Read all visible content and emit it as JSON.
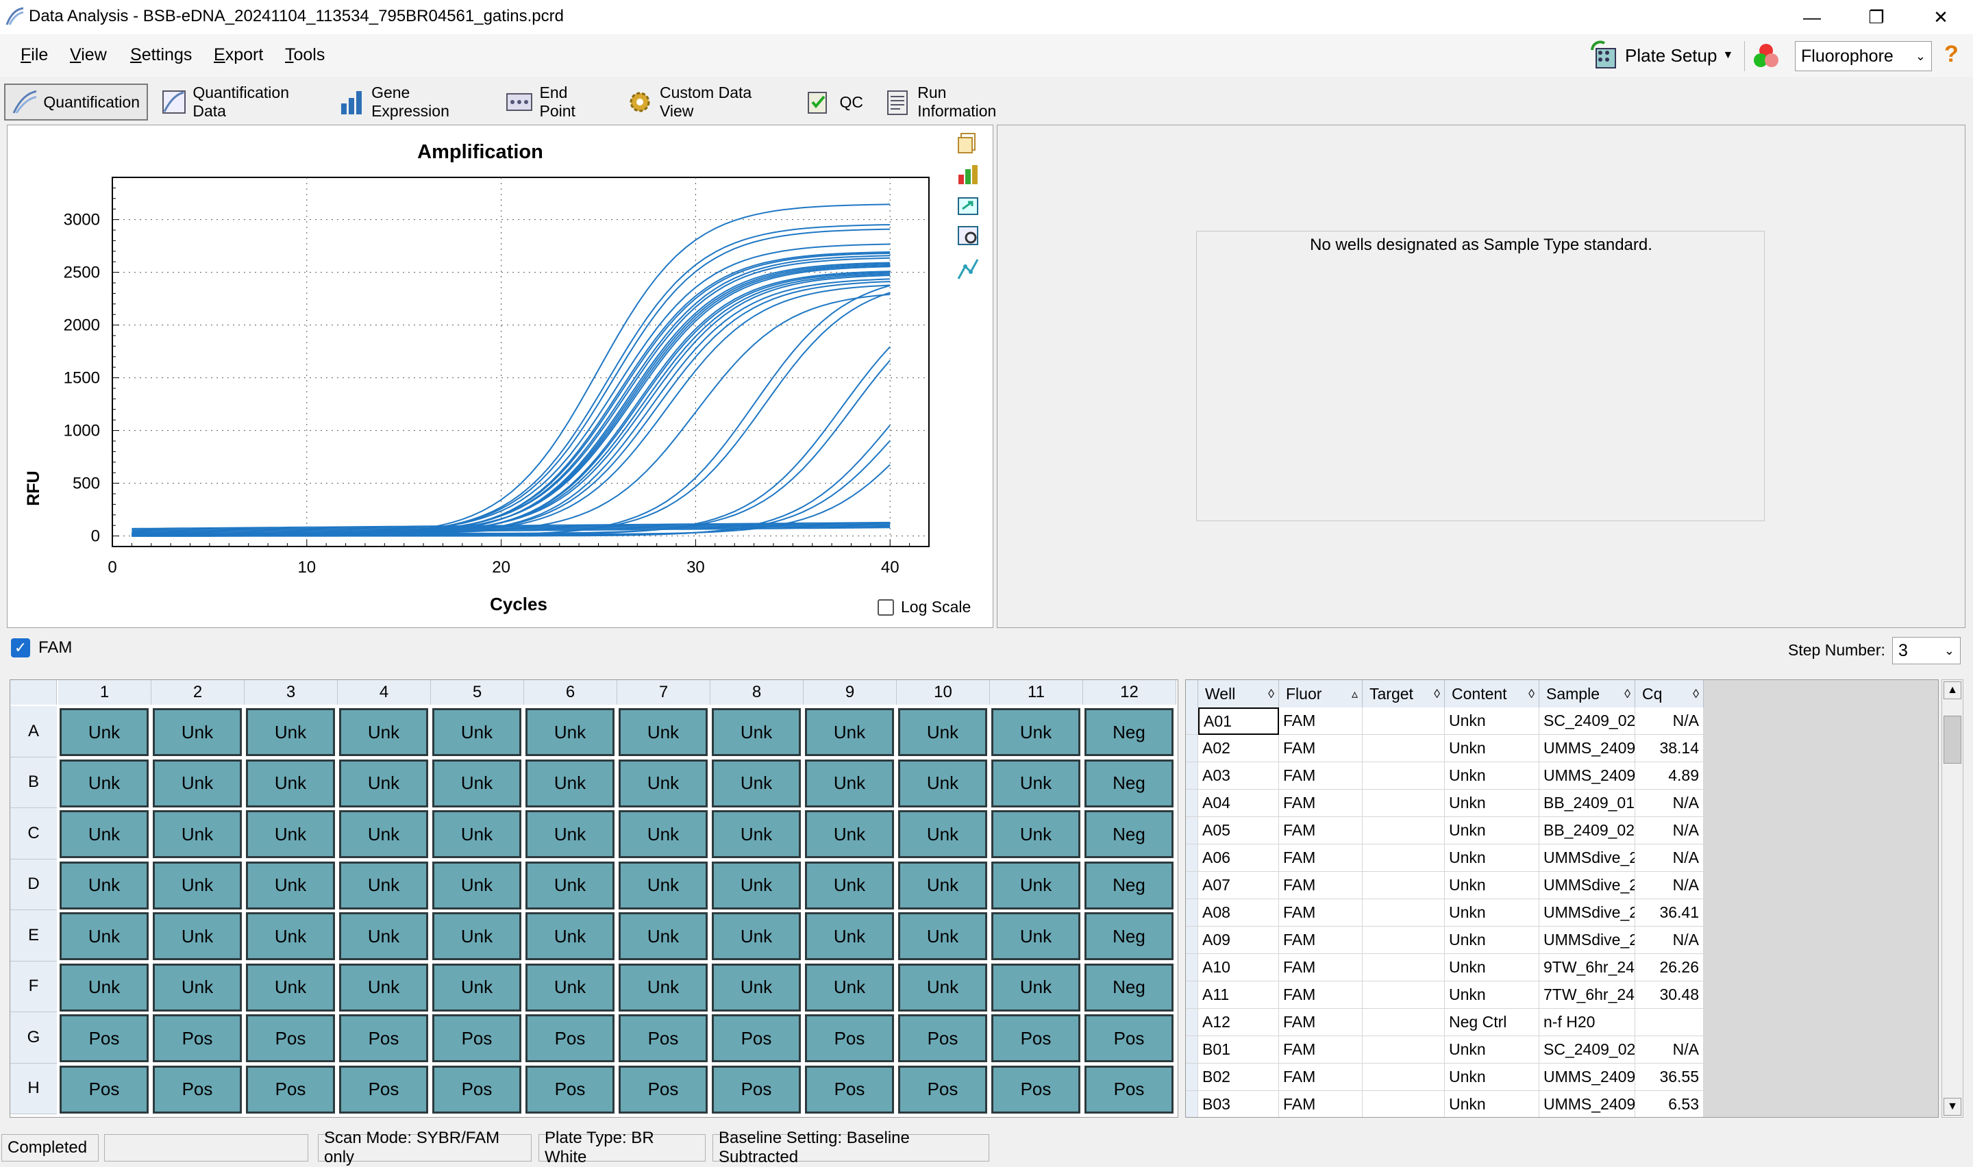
{
  "window": {
    "title": "Data Analysis - BSB-eDNA_20241104_113534_795BR04561_gatins.pcrd",
    "minimize": "—",
    "maximize": "❐",
    "close": "✕"
  },
  "menu": [
    "File",
    "View",
    "Settings",
    "Export",
    "Tools"
  ],
  "header_right": {
    "plate_setup": "Plate Setup",
    "fluorophore_select": "Fluorophore",
    "help": "?"
  },
  "tabs": [
    {
      "label": "Quantification",
      "icon": "amplification-icon",
      "active": true
    },
    {
      "label": "Quantification Data",
      "icon": "quant-data-icon"
    },
    {
      "label": "Gene Expression",
      "icon": "bar-chart-icon"
    },
    {
      "label": "End Point",
      "icon": "end-point-icon"
    },
    {
      "label": "Custom Data View",
      "icon": "gear-icon"
    },
    {
      "label": "QC",
      "icon": "qc-icon"
    },
    {
      "label": "Run Information",
      "icon": "run-info-icon"
    }
  ],
  "chart_data": {
    "type": "line",
    "title": "Amplification",
    "xlabel": "Cycles",
    "ylabel": "RFU",
    "xlim": [
      0,
      42
    ],
    "ylim": [
      -100,
      3400
    ],
    "xticks": [
      0,
      10,
      20,
      30,
      40
    ],
    "yticks": [
      0,
      500,
      1000,
      1500,
      2000,
      2500,
      3000
    ],
    "grid": true,
    "log_scale_label": "Log Scale",
    "log_scale_checked": false,
    "series_color": "#1f77c4",
    "series": [
      {
        "cq": 19.5,
        "max": 3150
      },
      {
        "cq": 20.0,
        "max": 2950
      },
      {
        "cq": 20.2,
        "max": 2900
      },
      {
        "cq": 20.4,
        "max": 2750
      },
      {
        "cq": 20.5,
        "max": 2700
      },
      {
        "cq": 20.6,
        "max": 2680
      },
      {
        "cq": 20.8,
        "max": 2650
      },
      {
        "cq": 20.9,
        "max": 2620
      },
      {
        "cq": 21.0,
        "max": 2600
      },
      {
        "cq": 21.1,
        "max": 2580
      },
      {
        "cq": 21.2,
        "max": 2560
      },
      {
        "cq": 21.3,
        "max": 2540
      },
      {
        "cq": 21.5,
        "max": 2520
      },
      {
        "cq": 21.6,
        "max": 2500
      },
      {
        "cq": 21.8,
        "max": 2480
      },
      {
        "cq": 22.0,
        "max": 2460
      },
      {
        "cq": 22.2,
        "max": 2450
      },
      {
        "cq": 22.5,
        "max": 2420
      },
      {
        "cq": 23.0,
        "max": 2380
      },
      {
        "cq": 24.5,
        "max": 2300
      },
      {
        "cq": 27.5,
        "max": 2500
      },
      {
        "cq": 28.0,
        "max": 2450
      },
      {
        "cq": 32.0,
        "max": 2400
      },
      {
        "cq": 32.5,
        "max": 2350
      },
      {
        "cq": 34.5,
        "max": 2100
      },
      {
        "cq": 35.0,
        "max": 2000
      },
      {
        "cq": 36.0,
        "max": 1900
      },
      {
        "cq": null,
        "max": 0
      },
      {
        "cq": null,
        "max": 0
      },
      {
        "cq": null,
        "max": 0
      },
      {
        "cq": null,
        "max": 0
      },
      {
        "cq": null,
        "max": 0
      }
    ]
  },
  "standard_curve_message": "No wells designated as Sample Type standard.",
  "fluor_filter": {
    "label": "FAM",
    "checked": true
  },
  "step": {
    "label": "Step Number:",
    "value": "3"
  },
  "plate": {
    "columns": [
      "1",
      "2",
      "3",
      "4",
      "5",
      "6",
      "7",
      "8",
      "9",
      "10",
      "11",
      "12"
    ],
    "rows": [
      {
        "label": "A",
        "wells": [
          "Unk",
          "Unk",
          "Unk",
          "Unk",
          "Unk",
          "Unk",
          "Unk",
          "Unk",
          "Unk",
          "Unk",
          "Unk",
          "Neg"
        ]
      },
      {
        "label": "B",
        "wells": [
          "Unk",
          "Unk",
          "Unk",
          "Unk",
          "Unk",
          "Unk",
          "Unk",
          "Unk",
          "Unk",
          "Unk",
          "Unk",
          "Neg"
        ]
      },
      {
        "label": "C",
        "wells": [
          "Unk",
          "Unk",
          "Unk",
          "Unk",
          "Unk",
          "Unk",
          "Unk",
          "Unk",
          "Unk",
          "Unk",
          "Unk",
          "Neg"
        ]
      },
      {
        "label": "D",
        "wells": [
          "Unk",
          "Unk",
          "Unk",
          "Unk",
          "Unk",
          "Unk",
          "Unk",
          "Unk",
          "Unk",
          "Unk",
          "Unk",
          "Neg"
        ]
      },
      {
        "label": "E",
        "wells": [
          "Unk",
          "Unk",
          "Unk",
          "Unk",
          "Unk",
          "Unk",
          "Unk",
          "Unk",
          "Unk",
          "Unk",
          "Unk",
          "Neg"
        ]
      },
      {
        "label": "F",
        "wells": [
          "Unk",
          "Unk",
          "Unk",
          "Unk",
          "Unk",
          "Unk",
          "Unk",
          "Unk",
          "Unk",
          "Unk",
          "Unk",
          "Neg"
        ]
      },
      {
        "label": "G",
        "wells": [
          "Pos",
          "Pos",
          "Pos",
          "Pos",
          "Pos",
          "Pos",
          "Pos",
          "Pos",
          "Pos",
          "Pos",
          "Pos",
          "Pos"
        ]
      },
      {
        "label": "H",
        "wells": [
          "Pos",
          "Pos",
          "Pos",
          "Pos",
          "Pos",
          "Pos",
          "Pos",
          "Pos",
          "Pos",
          "Pos",
          "Pos",
          "Pos"
        ]
      }
    ]
  },
  "results_table": {
    "headers": [
      "Well",
      "Fluor",
      "Target",
      "Content",
      "Sample",
      "Cq"
    ],
    "rows": [
      [
        "A01",
        "FAM",
        "",
        "Unkn",
        "SC_2409_02",
        "N/A"
      ],
      [
        "A02",
        "FAM",
        "",
        "Unkn",
        "UMMS_2409_",
        "38.14"
      ],
      [
        "A03",
        "FAM",
        "",
        "Unkn",
        "UMMS_2409_",
        "4.89"
      ],
      [
        "A04",
        "FAM",
        "",
        "Unkn",
        "BB_2409_01",
        "N/A"
      ],
      [
        "A05",
        "FAM",
        "",
        "Unkn",
        "BB_2409_02",
        "N/A"
      ],
      [
        "A06",
        "FAM",
        "",
        "Unkn",
        "UMMSdive_2",
        "N/A"
      ],
      [
        "A07",
        "FAM",
        "",
        "Unkn",
        "UMMSdive_2",
        "N/A"
      ],
      [
        "A08",
        "FAM",
        "",
        "Unkn",
        "UMMSdive_2",
        "36.41"
      ],
      [
        "A09",
        "FAM",
        "",
        "Unkn",
        "UMMSdive_2",
        "N/A"
      ],
      [
        "A10",
        "FAM",
        "",
        "Unkn",
        "9TW_6hr_24",
        "26.26"
      ],
      [
        "A11",
        "FAM",
        "",
        "Unkn",
        "7TW_6hr_24",
        "30.48"
      ],
      [
        "A12",
        "FAM",
        "",
        "Neg Ctrl",
        "n-f H20",
        ""
      ],
      [
        "B01",
        "FAM",
        "",
        "Unkn",
        "SC_2409_02",
        "N/A"
      ],
      [
        "B02",
        "FAM",
        "",
        "Unkn",
        "UMMS_2409_",
        "36.55"
      ],
      [
        "B03",
        "FAM",
        "",
        "Unkn",
        "UMMS_2409_",
        "6.53"
      ]
    ]
  },
  "status": {
    "state": "Completed",
    "scan_mode": "Scan Mode: SYBR/FAM only",
    "plate_type": "Plate Type: BR White",
    "baseline": "Baseline Setting: Baseline Subtracted"
  }
}
